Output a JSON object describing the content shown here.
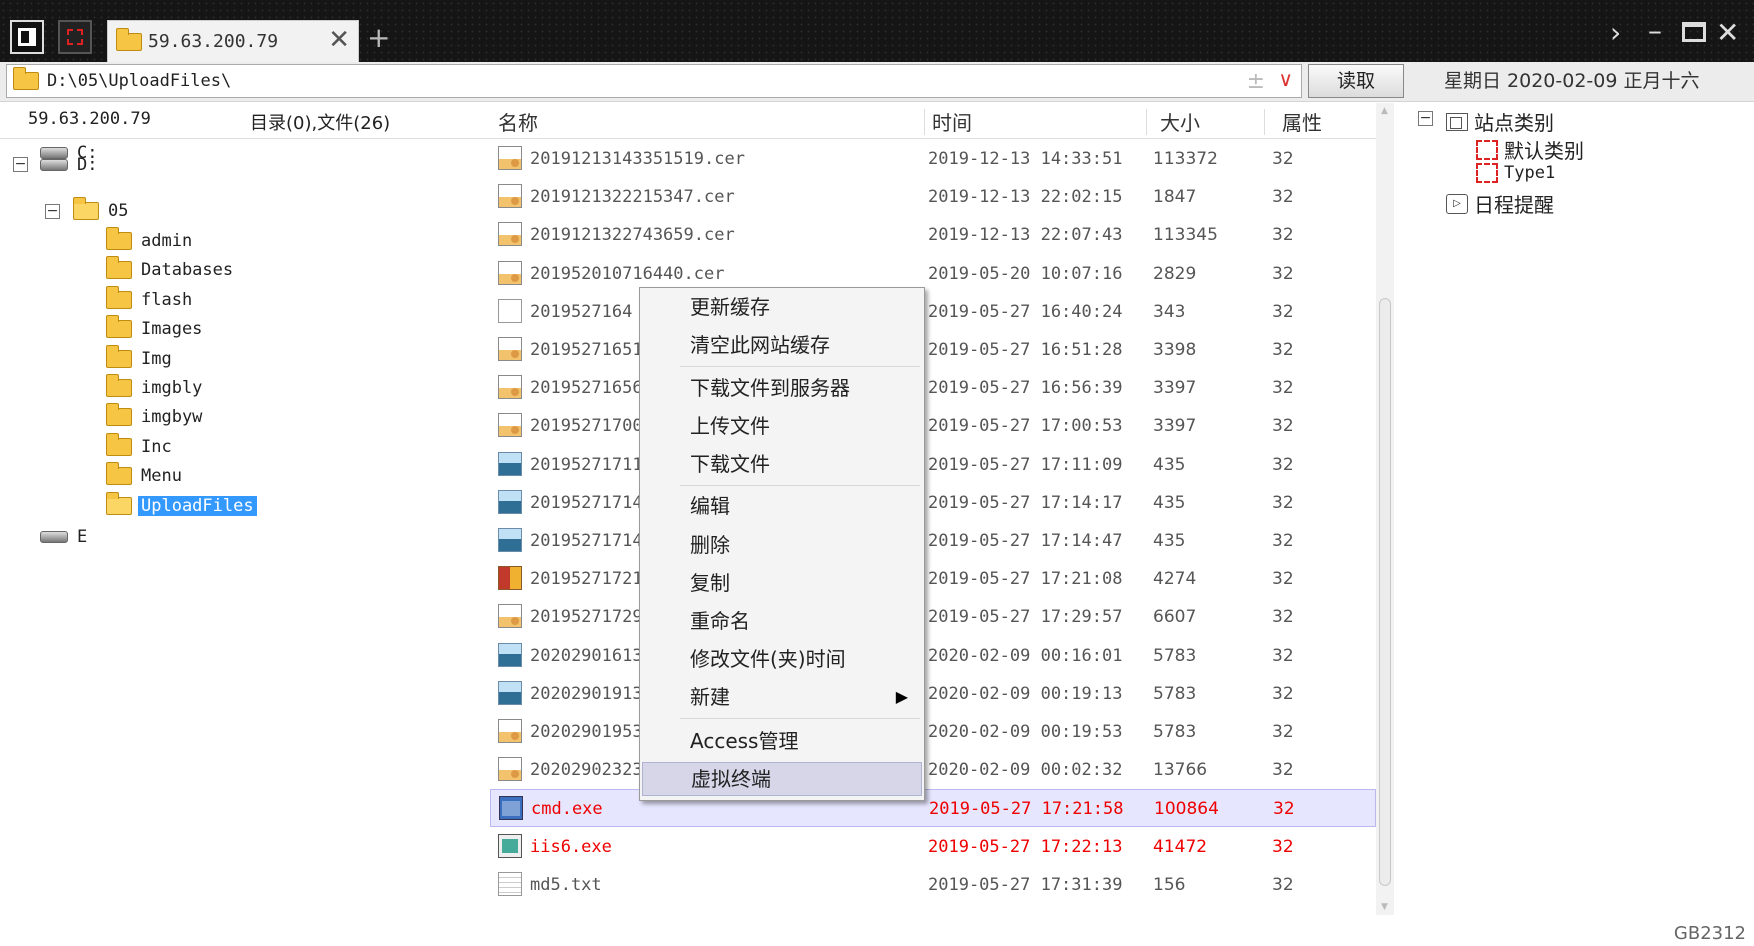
{
  "tab": {
    "title": "59.63.200.79",
    "close": "✕"
  },
  "toolbar": {
    "path": "D:\\05\\UploadFiles\\",
    "star": "±",
    "dropdown": "∨",
    "read_button": "读取",
    "date": "星期日 2020-02-09 正月十六"
  },
  "left": {
    "host": "59.63.200.79",
    "count": "目录(0),文件(26)",
    "tree": {
      "drive_c": "C:",
      "drive_d": "D:",
      "folder_05": "05",
      "folders": [
        "admin",
        "Databases",
        "flash",
        "Images",
        "Img",
        "imgbly",
        "imgbyw",
        "Inc",
        "Menu",
        "UploadFiles"
      ],
      "drive_e": "E"
    }
  },
  "columns": {
    "name": "名称",
    "time": "时间",
    "size": "大小",
    "attr": "属性"
  },
  "files": [
    {
      "name": "20191213143351519.cer",
      "time": "2019-12-13 14:33:51",
      "size": "113372",
      "attr": "32",
      "icon": "certificate-icon"
    },
    {
      "name": "2019121322215347.cer",
      "time": "2019-12-13 22:02:15",
      "size": "1847",
      "attr": "32",
      "icon": "certificate-icon"
    },
    {
      "name": "2019121322743659.cer",
      "time": "2019-12-13 22:07:43",
      "size": "113345",
      "attr": "32",
      "icon": "certificate-icon"
    },
    {
      "name": "201952010716440.cer",
      "time": "2019-05-20 10:07:16",
      "size": "2829",
      "attr": "32",
      "icon": "certificate-icon"
    },
    {
      "name": "2019527164",
      "time": "2019-05-27 16:40:24",
      "size": "343",
      "attr": "32",
      "icon": "document-icon"
    },
    {
      "name": "201952716512",
      "time": "2019-05-27 16:51:28",
      "size": "3398",
      "attr": "32",
      "icon": "certificate-icon"
    },
    {
      "name": "201952716563",
      "time": "2019-05-27 16:56:39",
      "size": "3397",
      "attr": "32",
      "icon": "certificate-icon"
    },
    {
      "name": "201952717005",
      "time": "2019-05-27 17:00:53",
      "size": "3397",
      "attr": "32",
      "icon": "certificate-icon"
    },
    {
      "name": "201952717111",
      "time": "2019-05-27 17:11:09",
      "size": "435",
      "attr": "32",
      "icon": "image-icon"
    },
    {
      "name": "201952717141",
      "time": "2019-05-27 17:14:17",
      "size": "435",
      "attr": "32",
      "icon": "image-icon"
    },
    {
      "name": "201952717144",
      "time": "2019-05-27 17:14:47",
      "size": "435",
      "attr": "32",
      "icon": "image-icon"
    },
    {
      "name": "201952717210",
      "time": "2019-05-27 17:21:08",
      "size": "4274",
      "attr": "32",
      "icon": "picture-icon"
    },
    {
      "name": "201952717295",
      "time": "2019-05-27 17:29:57",
      "size": "6607",
      "attr": "32",
      "icon": "certificate-icon"
    },
    {
      "name": "202029016130",
      "time": "2020-02-09 00:16:01",
      "size": "5783",
      "attr": "32",
      "icon": "image-icon"
    },
    {
      "name": "202029019131",
      "time": "2020-02-09 00:19:13",
      "size": "5783",
      "attr": "32",
      "icon": "image-icon"
    },
    {
      "name": "202029019535",
      "time": "2020-02-09 00:19:53",
      "size": "5783",
      "attr": "32",
      "icon": "certificate-icon"
    },
    {
      "name": "202029023232",
      "time": "2020-02-09 00:02:32",
      "size": "13766",
      "attr": "32",
      "icon": "certificate-icon"
    },
    {
      "name": "cmd.exe",
      "time": "2019-05-27 17:21:58",
      "size": "100864",
      "attr": "32",
      "icon": "executable-icon"
    },
    {
      "name": "iis6.exe",
      "time": "2019-05-27 17:22:13",
      "size": "41472",
      "attr": "32",
      "icon": "executable-icon"
    },
    {
      "name": "md5.txt",
      "time": "2019-05-27 17:31:39",
      "size": "156",
      "attr": "32",
      "icon": "text-file-icon"
    }
  ],
  "right": {
    "site_category": "站点类别",
    "default_category": "默认类别",
    "type1": "Type1",
    "schedule": "日程提醒"
  },
  "context_menu": {
    "refresh_cache": "更新缓存",
    "clear_site_cache": "清空此网站缓存",
    "download_to_server": "下载文件到服务器",
    "upload_file": "上传文件",
    "download_file": "下载文件",
    "edit": "编辑",
    "delete": "删除",
    "copy": "复制",
    "rename": "重命名",
    "modify_time": "修改文件(夹)时间",
    "new": "新建",
    "access_manage": "Access管理",
    "virtual_terminal": "虚拟终端"
  },
  "footer": {
    "encoding": "GB2312"
  },
  "colors": {
    "highlight_row": "#e6e6ff",
    "exe_text": "#e00000",
    "selection": "#3399ff"
  }
}
